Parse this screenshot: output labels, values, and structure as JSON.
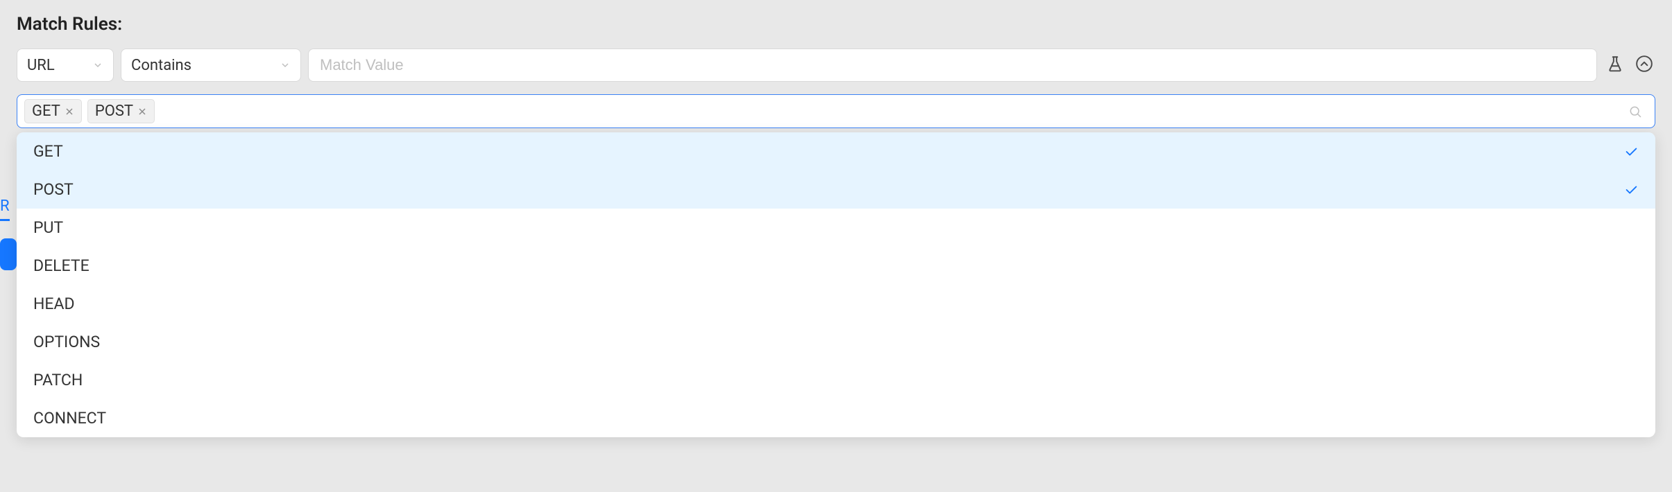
{
  "section": {
    "title": "Match Rules:"
  },
  "filter": {
    "field_select": {
      "value": "URL"
    },
    "operator_select": {
      "value": "Contains"
    },
    "value_input": {
      "placeholder": "Match Value",
      "value": ""
    }
  },
  "multi_select": {
    "tags": [
      {
        "label": "GET"
      },
      {
        "label": "POST"
      }
    ]
  },
  "dropdown": {
    "options": [
      {
        "label": "GET",
        "selected": true
      },
      {
        "label": "POST",
        "selected": true
      },
      {
        "label": "PUT",
        "selected": false
      },
      {
        "label": "DELETE",
        "selected": false
      },
      {
        "label": "HEAD",
        "selected": false
      },
      {
        "label": "OPTIONS",
        "selected": false
      },
      {
        "label": "PATCH",
        "selected": false
      },
      {
        "label": "CONNECT",
        "selected": false
      }
    ]
  },
  "side_peek": {
    "text": "R"
  }
}
